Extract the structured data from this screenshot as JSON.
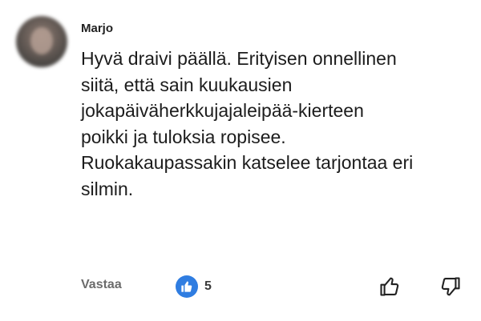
{
  "comment": {
    "author": "Marjo",
    "lines": [
      "Hyvä draivi päällä. Erityisen onnellinen",
      "siitä, että sain kuukausien",
      "jokapäiväherkkujajaleipää-kierteen",
      "poikki ja tuloksia ropisee.",
      "Ruokakaupassakin katselee tarjontaa eri",
      "silmin."
    ],
    "reply_label": "Vastaa",
    "like_count": "5"
  },
  "icons": {
    "like_badge": "thumbs-up-icon",
    "upvote": "thumbs-up-outline-icon",
    "downvote": "thumbs-down-outline-icon"
  },
  "colors": {
    "like_badge": "#2f7de1",
    "text": "#1c1c1c",
    "muted": "#6b6b6b"
  }
}
